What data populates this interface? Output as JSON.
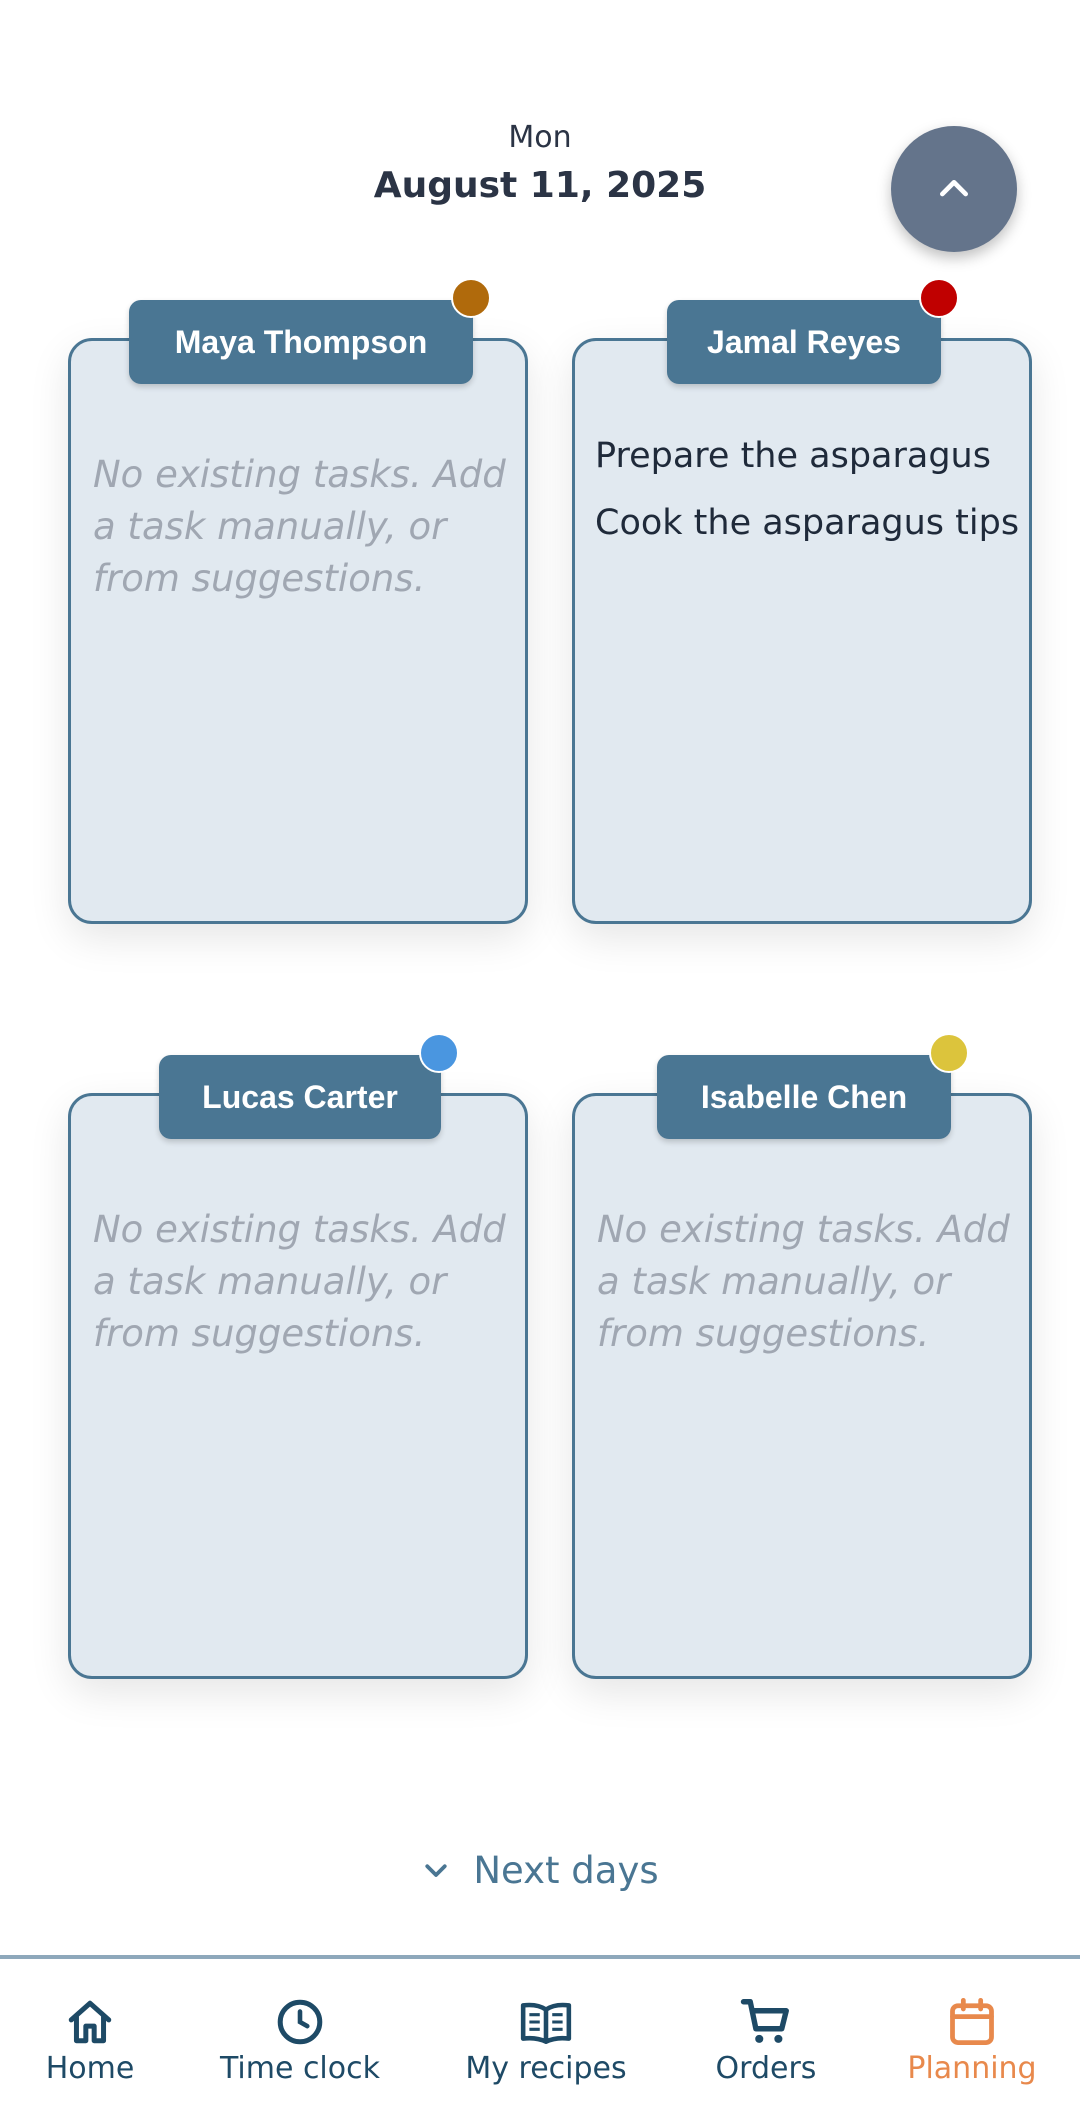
{
  "header": {
    "day": "Mon",
    "date": "August 11, 2025"
  },
  "scroll_up": {
    "icon": "chevron-up-icon"
  },
  "staff": [
    {
      "name": "Maya Thompson",
      "dot_color": "#b06a0c",
      "tasks": [],
      "empty_text": "No existing tasks. Add a task manually, or from suggestions."
    },
    {
      "name": "Jamal Reyes",
      "dot_color": "#c00000",
      "tasks": [
        "Prepare the asparagus",
        "Cook the asparagus tips"
      ],
      "empty_text": ""
    },
    {
      "name": "Lucas Carter",
      "dot_color": "#4a96e0",
      "tasks": [],
      "empty_text": "No existing tasks. Add a task manually, or from suggestions."
    },
    {
      "name": "Isabelle Chen",
      "dot_color": "#dcc43c",
      "tasks": [],
      "empty_text": "No existing tasks. Add a task manually, or from suggestions."
    }
  ],
  "next_days": {
    "label": "Next days",
    "icon": "chevron-down-icon"
  },
  "nav": {
    "active_color": "#e8894c",
    "items": [
      {
        "label": "Home",
        "icon": "home-icon"
      },
      {
        "label": "Time clock",
        "icon": "clock-icon"
      },
      {
        "label": "My recipes",
        "icon": "book-icon"
      },
      {
        "label": "Orders",
        "icon": "cart-icon"
      },
      {
        "label": "Planning",
        "icon": "calendar-icon",
        "active": true
      }
    ]
  }
}
